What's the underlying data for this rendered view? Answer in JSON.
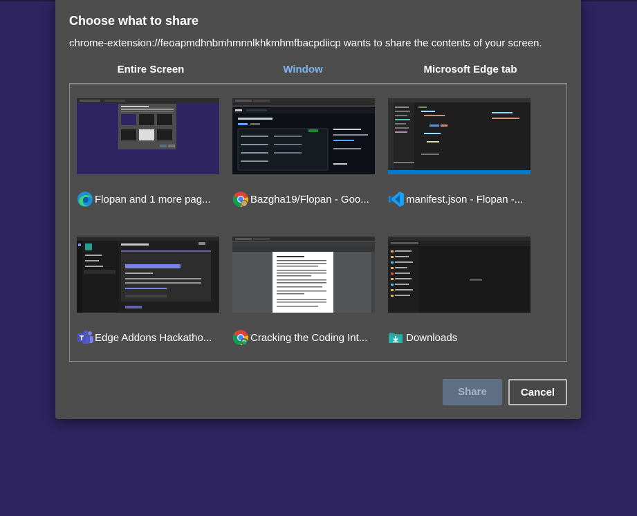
{
  "dialog": {
    "title": "Choose what to share",
    "subtitle": "chrome-extension://feoapmdhnbmhmnnlkhkmhmfbacpdiicp wants to share the contents of your screen."
  },
  "tabs": [
    {
      "label": "Entire Screen",
      "active": false
    },
    {
      "label": "Window",
      "active": true
    },
    {
      "label": "Microsoft Edge tab",
      "active": false
    }
  ],
  "windows": [
    {
      "label": "Flopan and 1 more pag...",
      "icon": "edge-icon"
    },
    {
      "label": "Bazgha19/Flopan - Goo...",
      "icon": "chrome-icon"
    },
    {
      "label": "manifest.json - Flopan -...",
      "icon": "vscode-icon"
    },
    {
      "label": "Edge Addons Hackatho...",
      "icon": "teams-icon"
    },
    {
      "label": "Cracking the Coding Int...",
      "icon": "chrome-icon"
    },
    {
      "label": "Downloads",
      "icon": "folder-download-icon"
    }
  ],
  "buttons": {
    "share": "Share",
    "cancel": "Cancel"
  },
  "colors": {
    "background": "#2e2461",
    "dialog": "#4d4d4d",
    "accent": "#7fb4f2"
  }
}
